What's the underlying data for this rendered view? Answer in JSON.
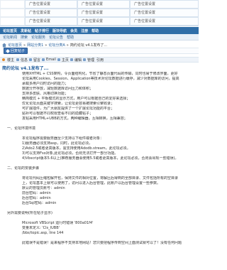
{
  "ads": {
    "row1": [
      "",
      "广告位置设置",
      "广告位置设置",
      "广告位置设置"
    ],
    "row2": [
      "",
      "广告位置设置",
      "广告位置设置",
      "广告位置设置"
    ],
    "row3": [
      "",
      "广告位置设置",
      "广告位置设置",
      "广告位置设置"
    ]
  },
  "main_nav": [
    "论坛首页",
    "发新帖",
    "帖子排行",
    "版块导航",
    "会员",
    "注册",
    "帮助"
  ],
  "sub_nav": [
    "论坛新闻",
    "搜索",
    "论坛服务",
    "论坛公告",
    "帮助"
  ],
  "breadcrumb": {
    "home": "论坛首页",
    "path": [
      "网站分类1",
      "论坛分类A"
    ],
    "current": "简约论坛 v4.1发布了..."
  },
  "pager": {
    "reply_btn": "回复帖子"
  },
  "post_bar": {
    "left": "楼主",
    "items": [
      "信息",
      "留言",
      "Email",
      "主页",
      "编辑",
      "管理"
    ],
    "right": "引用"
  },
  "post_title": "简约论坛 v4.1发布了...",
  "body_lines": [
    {
      "type": "p",
      "text": "使用XHTML + CSS架构，令页面结构化，节省了静态页面代码的传输，同时也易于修改界面，更好"
    },
    {
      "type": "p",
      "text": "论坛采用Cookies、Session、Application等技术对论坛数据进行缓存，减少对数据库的访问，提高"
    },
    {
      "type": "p",
      "text": "承载多用户同时访问的能力；"
    },
    {
      "type": "p",
      "text": "数据分开存放，减轻数据库访问压力和体积；"
    },
    {
      "type": "p",
      "text": "支持多皮肤、风格切换功能；"
    },
    {
      "type": "p",
      "text": "精简模式 + 平板模式的显示方式，用户可以根据自己的爱好来选择；"
    },
    {
      "type": "p",
      "text": "优化论坛页面关键字搜索，让论坛更容易被搜索引擎收录；"
    },
    {
      "type": "p",
      "text": "可扩展插件，为广大朋友提供了一个扩展论坛功能的平台；"
    },
    {
      "type": "p",
      "text": "贴补可以根据不同权限查看不同的隐藏帖子；"
    },
    {
      "type": "p",
      "text": "发帖采用HTML+UBB的方式，两种编辑器，互相转换，互相兼容；"
    },
    {
      "type": "gap",
      "text": ""
    },
    {
      "type": "h",
      "text": "一、论坛环境环境"
    },
    {
      "type": "gap",
      "text": ""
    },
    {
      "type": "p",
      "text": "本论坛程序需要服务器至少支持以下组件或者对象："
    },
    {
      "type": "p",
      "text": "1)服务器必须支持asp，同时，此论坛必须，"
    },
    {
      "type": "p",
      "text": "2)Ado2.5或者更高版本，需支持使用Adodb.stream，此论坛必须。"
    },
    {
      "type": "p",
      "text": "3)可以支持Fso对象,此论坛必须，否则无法打开一部分功能。"
    },
    {
      "type": "p",
      "text": "4)Vbscript版本5.6以上(推荐服务器会使用5.5或者更高版本，此论坛必须，否则会出现一些错误)。"
    },
    {
      "type": "gap",
      "text": ""
    },
    {
      "type": "h",
      "text": "二、论坛的安装步骤"
    },
    {
      "type": "gap",
      "text": ""
    },
    {
      "type": "p",
      "text": "将论坛代码压缩包解开包，保持文件的相对位置，将解压后得到的全部目录、文件包括所有的空目录"
    },
    {
      "type": "p",
      "text": "上，论坛基本上就可以使用了，访问以进入后台管理，此账户以后台管理设置一些参数。"
    },
    {
      "type": "p",
      "text": "默认的管理员账号：admin"
    },
    {
      "type": "p",
      "text": "前台密码：admin"
    },
    {
      "type": "p",
      "text": "后台密码：admin"
    },
    {
      "type": "p",
      "text": "后台Sql密码：admin"
    },
    {
      "type": "gap",
      "text": ""
    },
    {
      "type": "h",
      "text": "另外需要说明(所在帖子显示)"
    },
    {
      "type": "gap",
      "text": ""
    },
    {
      "type": "p",
      "text": "Microsoft VBScript 运行时错误 '800a01f4'"
    },
    {
      "type": "p",
      "text": "变量未定义: 'Cls_IUBB'"
    },
    {
      "type": "p",
      "text": "/bbs/topic.asp, line 144"
    },
    {
      "type": "gap",
      "text": ""
    },
    {
      "type": "p",
      "text": "此错误不是错误！是来程序不支持本地网站！您只要把程序传到空间上面测试就可以了！没有任何问题"
    }
  ]
}
